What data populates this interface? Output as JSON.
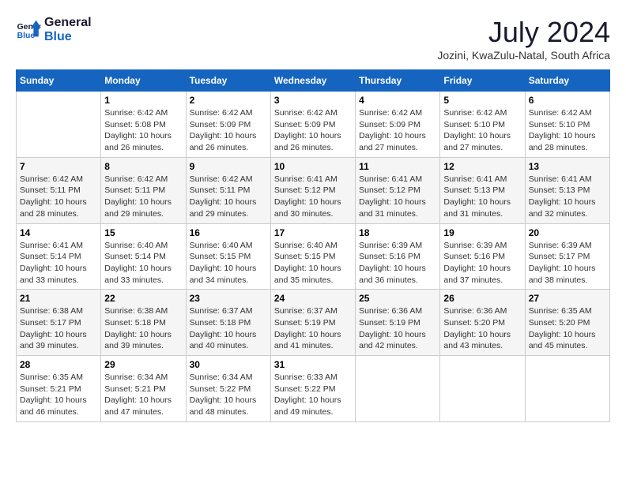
{
  "logo": {
    "line1": "General",
    "line2": "Blue"
  },
  "title": "July 2024",
  "subtitle": "Jozini, KwaZulu-Natal, South Africa",
  "weekdays": [
    "Sunday",
    "Monday",
    "Tuesday",
    "Wednesday",
    "Thursday",
    "Friday",
    "Saturday"
  ],
  "weeks": [
    [
      {
        "day": "",
        "sunrise": "",
        "sunset": "",
        "daylight": ""
      },
      {
        "day": "1",
        "sunrise": "Sunrise: 6:42 AM",
        "sunset": "Sunset: 5:08 PM",
        "daylight": "Daylight: 10 hours and 26 minutes."
      },
      {
        "day": "2",
        "sunrise": "Sunrise: 6:42 AM",
        "sunset": "Sunset: 5:09 PM",
        "daylight": "Daylight: 10 hours and 26 minutes."
      },
      {
        "day": "3",
        "sunrise": "Sunrise: 6:42 AM",
        "sunset": "Sunset: 5:09 PM",
        "daylight": "Daylight: 10 hours and 26 minutes."
      },
      {
        "day": "4",
        "sunrise": "Sunrise: 6:42 AM",
        "sunset": "Sunset: 5:09 PM",
        "daylight": "Daylight: 10 hours and 27 minutes."
      },
      {
        "day": "5",
        "sunrise": "Sunrise: 6:42 AM",
        "sunset": "Sunset: 5:10 PM",
        "daylight": "Daylight: 10 hours and 27 minutes."
      },
      {
        "day": "6",
        "sunrise": "Sunrise: 6:42 AM",
        "sunset": "Sunset: 5:10 PM",
        "daylight": "Daylight: 10 hours and 28 minutes."
      }
    ],
    [
      {
        "day": "7",
        "sunrise": "Sunrise: 6:42 AM",
        "sunset": "Sunset: 5:11 PM",
        "daylight": "Daylight: 10 hours and 28 minutes."
      },
      {
        "day": "8",
        "sunrise": "Sunrise: 6:42 AM",
        "sunset": "Sunset: 5:11 PM",
        "daylight": "Daylight: 10 hours and 29 minutes."
      },
      {
        "day": "9",
        "sunrise": "Sunrise: 6:42 AM",
        "sunset": "Sunset: 5:11 PM",
        "daylight": "Daylight: 10 hours and 29 minutes."
      },
      {
        "day": "10",
        "sunrise": "Sunrise: 6:41 AM",
        "sunset": "Sunset: 5:12 PM",
        "daylight": "Daylight: 10 hours and 30 minutes."
      },
      {
        "day": "11",
        "sunrise": "Sunrise: 6:41 AM",
        "sunset": "Sunset: 5:12 PM",
        "daylight": "Daylight: 10 hours and 31 minutes."
      },
      {
        "day": "12",
        "sunrise": "Sunrise: 6:41 AM",
        "sunset": "Sunset: 5:13 PM",
        "daylight": "Daylight: 10 hours and 31 minutes."
      },
      {
        "day": "13",
        "sunrise": "Sunrise: 6:41 AM",
        "sunset": "Sunset: 5:13 PM",
        "daylight": "Daylight: 10 hours and 32 minutes."
      }
    ],
    [
      {
        "day": "14",
        "sunrise": "Sunrise: 6:41 AM",
        "sunset": "Sunset: 5:14 PM",
        "daylight": "Daylight: 10 hours and 33 minutes."
      },
      {
        "day": "15",
        "sunrise": "Sunrise: 6:40 AM",
        "sunset": "Sunset: 5:14 PM",
        "daylight": "Daylight: 10 hours and 33 minutes."
      },
      {
        "day": "16",
        "sunrise": "Sunrise: 6:40 AM",
        "sunset": "Sunset: 5:15 PM",
        "daylight": "Daylight: 10 hours and 34 minutes."
      },
      {
        "day": "17",
        "sunrise": "Sunrise: 6:40 AM",
        "sunset": "Sunset: 5:15 PM",
        "daylight": "Daylight: 10 hours and 35 minutes."
      },
      {
        "day": "18",
        "sunrise": "Sunrise: 6:39 AM",
        "sunset": "Sunset: 5:16 PM",
        "daylight": "Daylight: 10 hours and 36 minutes."
      },
      {
        "day": "19",
        "sunrise": "Sunrise: 6:39 AM",
        "sunset": "Sunset: 5:16 PM",
        "daylight": "Daylight: 10 hours and 37 minutes."
      },
      {
        "day": "20",
        "sunrise": "Sunrise: 6:39 AM",
        "sunset": "Sunset: 5:17 PM",
        "daylight": "Daylight: 10 hours and 38 minutes."
      }
    ],
    [
      {
        "day": "21",
        "sunrise": "Sunrise: 6:38 AM",
        "sunset": "Sunset: 5:17 PM",
        "daylight": "Daylight: 10 hours and 39 minutes."
      },
      {
        "day": "22",
        "sunrise": "Sunrise: 6:38 AM",
        "sunset": "Sunset: 5:18 PM",
        "daylight": "Daylight: 10 hours and 39 minutes."
      },
      {
        "day": "23",
        "sunrise": "Sunrise: 6:37 AM",
        "sunset": "Sunset: 5:18 PM",
        "daylight": "Daylight: 10 hours and 40 minutes."
      },
      {
        "day": "24",
        "sunrise": "Sunrise: 6:37 AM",
        "sunset": "Sunset: 5:19 PM",
        "daylight": "Daylight: 10 hours and 41 minutes."
      },
      {
        "day": "25",
        "sunrise": "Sunrise: 6:36 AM",
        "sunset": "Sunset: 5:19 PM",
        "daylight": "Daylight: 10 hours and 42 minutes."
      },
      {
        "day": "26",
        "sunrise": "Sunrise: 6:36 AM",
        "sunset": "Sunset: 5:20 PM",
        "daylight": "Daylight: 10 hours and 43 minutes."
      },
      {
        "day": "27",
        "sunrise": "Sunrise: 6:35 AM",
        "sunset": "Sunset: 5:20 PM",
        "daylight": "Daylight: 10 hours and 45 minutes."
      }
    ],
    [
      {
        "day": "28",
        "sunrise": "Sunrise: 6:35 AM",
        "sunset": "Sunset: 5:21 PM",
        "daylight": "Daylight: 10 hours and 46 minutes."
      },
      {
        "day": "29",
        "sunrise": "Sunrise: 6:34 AM",
        "sunset": "Sunset: 5:21 PM",
        "daylight": "Daylight: 10 hours and 47 minutes."
      },
      {
        "day": "30",
        "sunrise": "Sunrise: 6:34 AM",
        "sunset": "Sunset: 5:22 PM",
        "daylight": "Daylight: 10 hours and 48 minutes."
      },
      {
        "day": "31",
        "sunrise": "Sunrise: 6:33 AM",
        "sunset": "Sunset: 5:22 PM",
        "daylight": "Daylight: 10 hours and 49 minutes."
      },
      {
        "day": "",
        "sunrise": "",
        "sunset": "",
        "daylight": ""
      },
      {
        "day": "",
        "sunrise": "",
        "sunset": "",
        "daylight": ""
      },
      {
        "day": "",
        "sunrise": "",
        "sunset": "",
        "daylight": ""
      }
    ]
  ]
}
